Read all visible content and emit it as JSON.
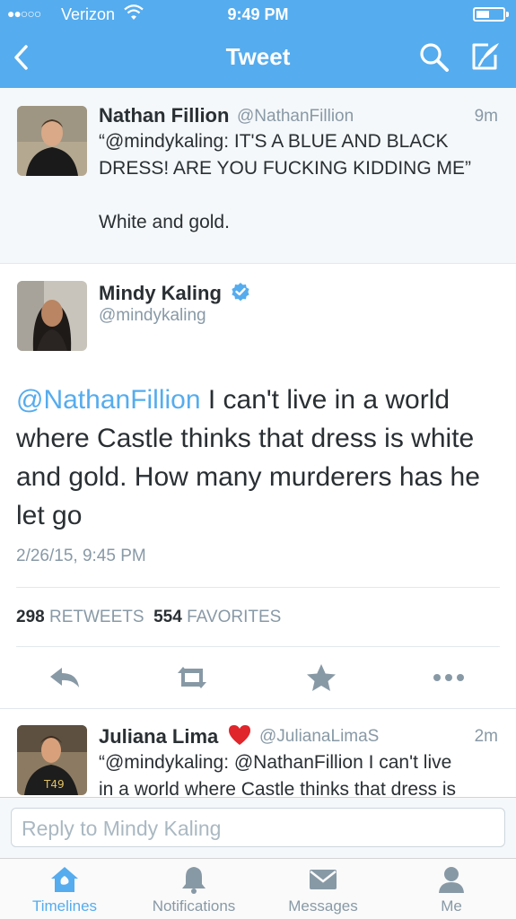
{
  "status_bar": {
    "signal": "●●○○○",
    "carrier": "Verizon",
    "time": "9:49 PM"
  },
  "nav": {
    "title": "Tweet",
    "icons": [
      "back-icon",
      "search-icon",
      "compose-icon"
    ]
  },
  "quoted_tweet": {
    "name": "Nathan Fillion",
    "handle": "@NathanFillion",
    "time": "9m",
    "line1": "“@mindykaling: IT'S A BLUE AND BLACK",
    "line2": "DRESS! ARE YOU FUCKING KIDDING ME”",
    "line3": "White and gold."
  },
  "main_tweet": {
    "name": "Mindy Kaling",
    "handle": "@mindykaling",
    "verified": true,
    "mention": "@NathanFillion",
    "text": " I can't live in a world where Castle thinks that dress is white and gold. How many murderers has he let go",
    "timestamp": "2/26/15, 9:45 PM",
    "retweets_count": "298",
    "retweets_label": "RETWEETS",
    "favorites_count": "554",
    "favorites_label": "FAVORITES",
    "actions": [
      "reply-icon",
      "retweet-icon",
      "favorite-icon",
      "more-icon"
    ]
  },
  "reply_tweet": {
    "name": "Juliana Lima",
    "handle": "@JulianaLimaS",
    "time": "2m",
    "line1": "“@mindykaling: @NathanFillion I can't live",
    "line2": "in a world where Castle thinks that dress is"
  },
  "reply_box": {
    "placeholder": "Reply to Mindy Kaling"
  },
  "tabs": [
    {
      "label": "Timelines",
      "icon": "home-icon",
      "active": true
    },
    {
      "label": "Notifications",
      "icon": "bell-icon",
      "active": false
    },
    {
      "label": "Messages",
      "icon": "envelope-icon",
      "active": false
    },
    {
      "label": "Me",
      "icon": "person-icon",
      "active": false
    }
  ],
  "colors": {
    "brand": "#55acee",
    "text": "#292f33",
    "muted": "#8899a6"
  }
}
